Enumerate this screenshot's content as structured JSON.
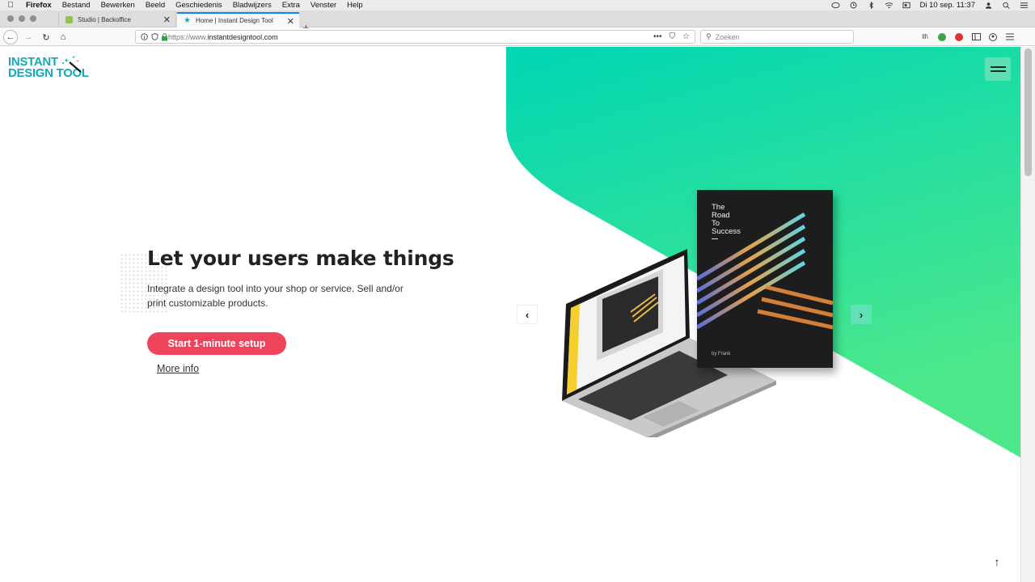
{
  "menubar": {
    "app_name": "Firefox",
    "items": [
      "Bestand",
      "Bewerken",
      "Beeld",
      "Geschiedenis",
      "Bladwijzers",
      "Extra",
      "Venster",
      "Help"
    ],
    "clock": "Di 10 sep.  11:37"
  },
  "tabs": [
    {
      "label": "Studio | Backoffice",
      "active": false
    },
    {
      "label": "Home | Instant Design Tool",
      "active": true
    }
  ],
  "navbar": {
    "url_prefix": "https://www.",
    "url_domain": "instantdesigntool.com",
    "search_placeholder": "Zoeken"
  },
  "page": {
    "logo_line1": "INSTANT",
    "logo_line2": "DESIGN TOOL",
    "headline": "Let your users make things",
    "subline": "Integrate a design tool into your shop or service. Sell and/or print customizable products.",
    "cta_label": "Start 1-minute setup",
    "more_label": "More info",
    "book_title": [
      "The",
      "Road",
      "To",
      "Success"
    ],
    "book_author": "by Frank",
    "prev_arrow": "‹",
    "next_arrow": "›",
    "scroll_top": "↑"
  },
  "colors": {
    "brand_teal": "#15a9b5",
    "accent_green_top": "#00d6b4",
    "accent_green_bottom": "#4ee88a",
    "cta": "#f0445c"
  }
}
